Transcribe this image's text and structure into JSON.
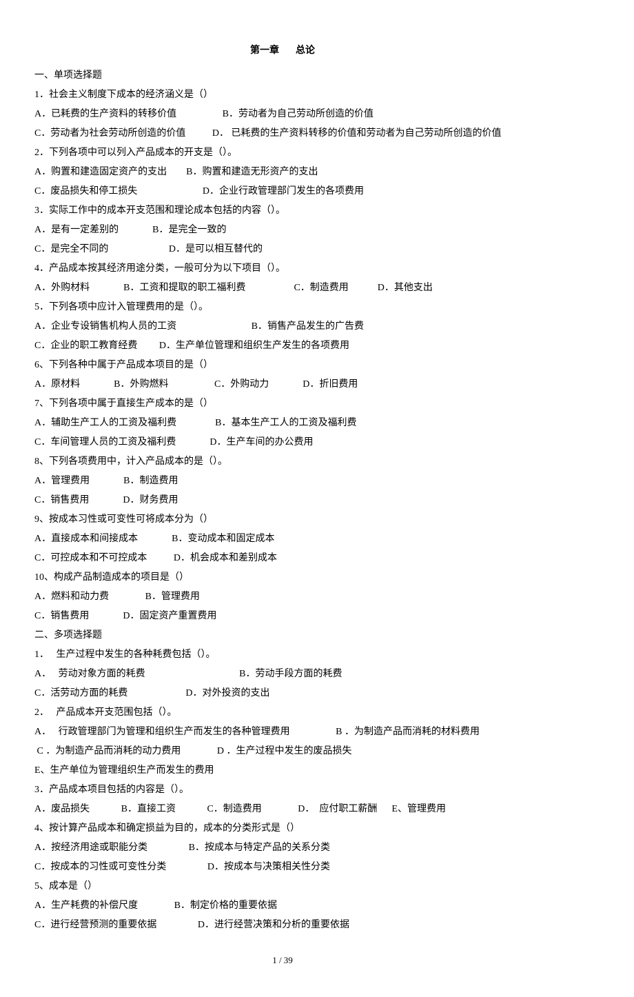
{
  "title_part1": "第一章",
  "title_part2": "总论",
  "lines": [
    "一、单项选择题",
    "1．社会主义制度下成本的经济涵义是（）",
    "A．已耗费的生产资料的转移价值                   B．劳动者为自己劳动所创造的价值",
    "C．劳动者为社会劳动所创造的价值           D． 已耗费的生产资料转移的价值和劳动者为自己劳动所创造的价值",
    "2．下列各项中可以列入产品成本的开支是（）。",
    "A．购置和建造固定资产的支出        B．购置和建造无形资产的支出",
    "C．废品损失和停工损失                           D．企业行政管理部门发生的各项费用",
    "3．实际工作中的成本开支范围和理论成本包括的内容（）。",
    "A．是有一定差别的              B．是完全一致的",
    "C．是完全不同的                         D．是可以相互替代的",
    "4．产品成本按其经济用途分类，一般可分为以下项目（）。",
    "A．外购材料              B．工资和提取的职工福利费                    C．制造费用            D．其他支出",
    "5．下列各项中应计入管理费用的是（）。",
    "A．企业专设销售机构人员的工资                               B．销售产品发生的广告费",
    "C．企业的职工教育经费         D．生产单位管理和组织生产发生的各项费用",
    "6、下列各种中属于产品成本项目的是（）",
    "A．原材料              B．外购燃料                   C．外购动力              D．折旧费用",
    "7、下列各项中属于直接生产成本的是（）",
    "A．辅助生产工人的工资及福利费                B．基本生产工人的工资及福利费",
    "C．车间管理人员的工资及福利费              D．生产车间的办公费用",
    "8、下列各项费用中，计入产品成本的是（）。",
    "A．管理费用              B．制造费用",
    "C．销售费用              D．财务费用",
    "9、按成本习性或可变性可将成本分为（）",
    "A．直接成本和间接成本              B．变动成本和固定成本",
    "C．可控成本和不可控成本           D．机会成本和差别成本",
    "10、构成产品制造成本的项目是（）",
    "A．燃料和动力费               B．管理费用",
    "C．销售费用              D．固定资产重置费用",
    "二、多项选择题",
    "1．   生产过程中发生的各种耗费包括（）。",
    "A．   劳动对象方面的耗费                                       B．劳动手段方面的耗费",
    "C．活劳动方面的耗费                        D．对外投资的支出",
    "2．   产品成本开支范围包括（）。",
    "A．   行政管理部门为管理和组织生产而发生的各种管理费用                   B ．为制造产品而消耗的材料费用",
    " C ．为制造产品而消耗的动力费用               D ．生产过程中发生的废品损失",
    "E、生产单位为管理组织生产而发生的费用",
    "3．产品成本项目包括的内容是（）。",
    "A．废品损失             B．直接工资             C．制造费用               D．  应付职工薪酬      E、管理费用",
    "4、按计算产品成本和确定损益为目的，成本的分类形式是（）",
    "A．按经济用途或职能分类                 B．按成本与特定产品的关系分类",
    "C．按成本的习性或可变性分类                 D．按成本与决策相关性分类",
    "5、成本是（）",
    "A．生产耗费的补偿尺度               B．制定价格的重要依据",
    "C．进行经营预测的重要依据                 D．进行经营决策和分析的重要依据"
  ],
  "footer": "1  /  39"
}
